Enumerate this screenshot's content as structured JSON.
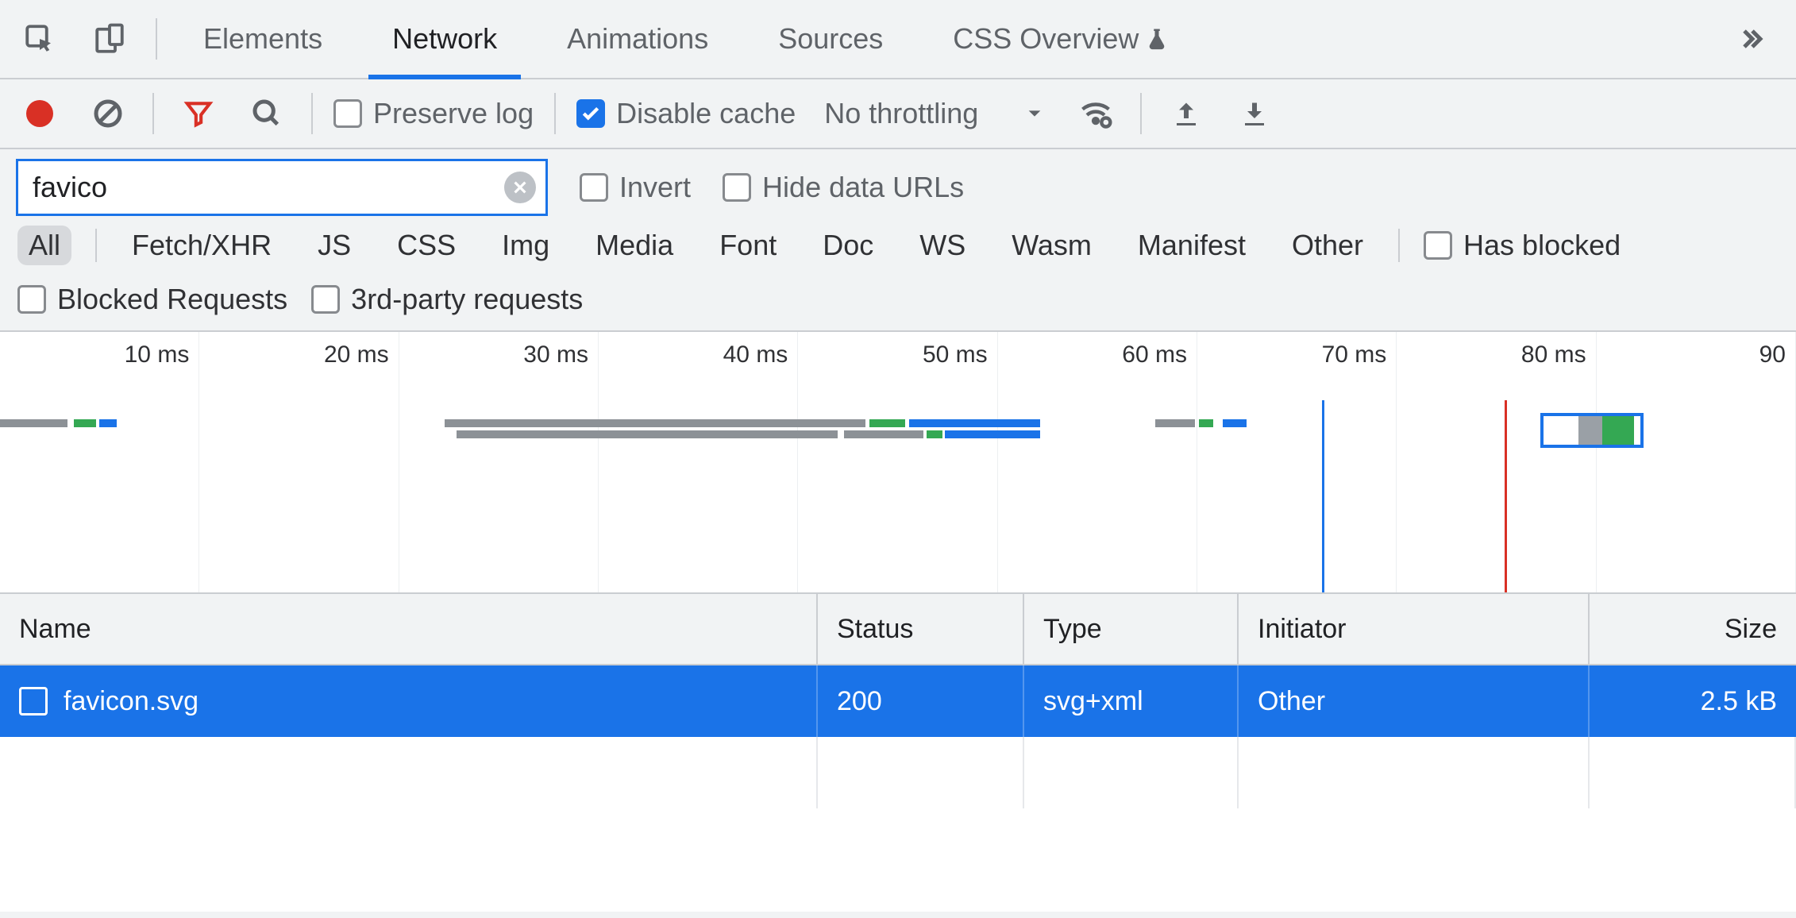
{
  "tabs": {
    "elements": "Elements",
    "network": "Network",
    "animations": "Animations",
    "sources": "Sources",
    "css_overview": "CSS Overview"
  },
  "controls": {
    "preserve_log": "Preserve log",
    "disable_cache": "Disable cache",
    "throttling": "No throttling"
  },
  "filter": {
    "value": "favico",
    "invert": "Invert",
    "hide_data_urls": "Hide data URLs"
  },
  "types": {
    "all": "All",
    "fetch": "Fetch/XHR",
    "js": "JS",
    "css": "CSS",
    "img": "Img",
    "media": "Media",
    "font": "Font",
    "doc": "Doc",
    "ws": "WS",
    "wasm": "Wasm",
    "manifest": "Manifest",
    "other": "Other",
    "has_blocked": "Has blocked",
    "blocked_requests": "Blocked Requests",
    "third_party": "3rd-party requests"
  },
  "timeline": {
    "ticks": [
      "10 ms",
      "20 ms",
      "30 ms",
      "40 ms",
      "50 ms",
      "60 ms",
      "70 ms",
      "80 ms",
      "90"
    ]
  },
  "table": {
    "headers": {
      "name": "Name",
      "status": "Status",
      "type": "Type",
      "initiator": "Initiator",
      "size": "Size"
    },
    "rows": [
      {
        "name": "favicon.svg",
        "status": "200",
        "type": "svg+xml",
        "initiator": "Other",
        "size": "2.5 kB"
      }
    ]
  }
}
